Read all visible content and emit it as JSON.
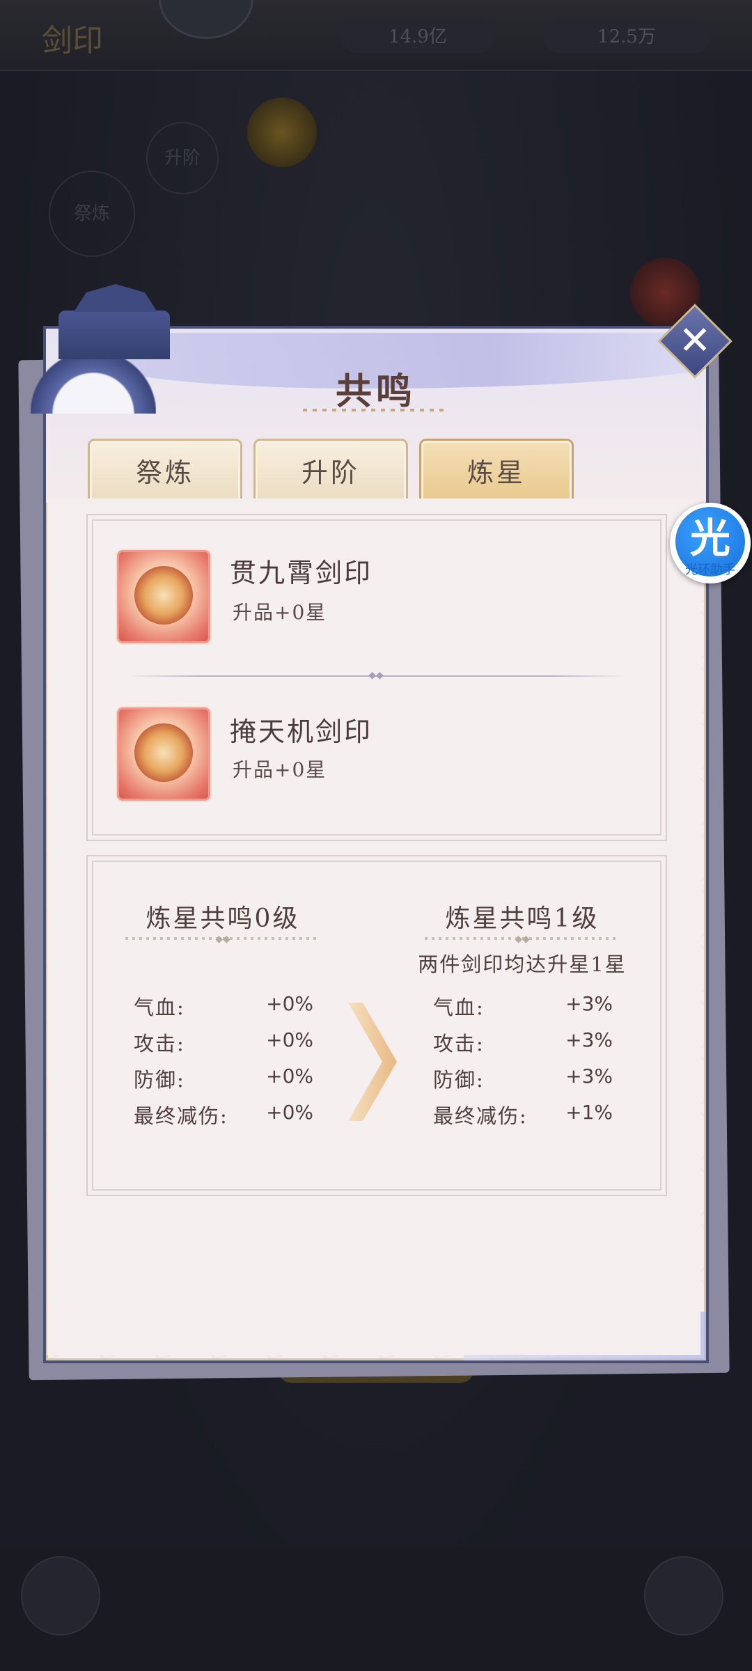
{
  "background": {
    "title": "剑印",
    "currency1": "14.9亿",
    "currency2": "12.5万",
    "circle1": "升阶",
    "circle2": "祭炼"
  },
  "dialog": {
    "title": "共鸣",
    "close_label": "✕",
    "tabs": [
      {
        "label": "祭炼",
        "active": false
      },
      {
        "label": "升阶",
        "active": false
      },
      {
        "label": "炼星",
        "active": true
      }
    ],
    "items": [
      {
        "name": "贯九霄剑印",
        "star": "升品+0星"
      },
      {
        "name": "掩天机剑印",
        "star": "升品+0星"
      }
    ],
    "current": {
      "title": "炼星共鸣0级",
      "stats": [
        {
          "label": "气血:",
          "value": "+0%"
        },
        {
          "label": "攻击:",
          "value": "+0%"
        },
        {
          "label": "防御:",
          "value": "+0%"
        },
        {
          "label": "最终减伤:",
          "value": "+0%"
        }
      ]
    },
    "next": {
      "title": "炼星共鸣1级",
      "condition": "两件剑印均达升星1星",
      "stats": [
        {
          "label": "气血:",
          "value": "+3%"
        },
        {
          "label": "攻击:",
          "value": "+3%"
        },
        {
          "label": "防御:",
          "value": "+3%"
        },
        {
          "label": "最终减伤:",
          "value": "+1%"
        }
      ]
    }
  },
  "helper": {
    "glyph": "光",
    "label": "光环助手"
  }
}
